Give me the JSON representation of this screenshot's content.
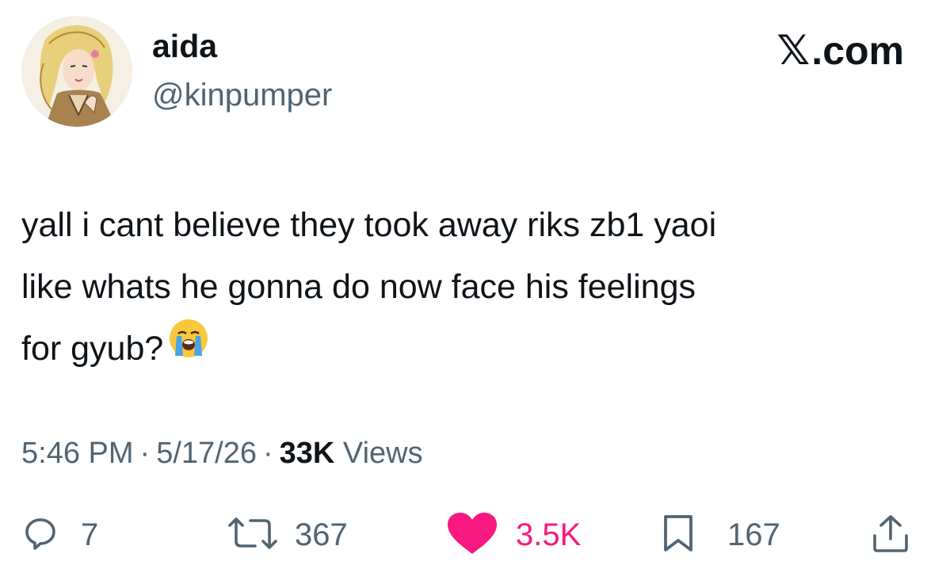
{
  "author": {
    "display_name": "aida",
    "handle": "@kinpumper",
    "avatar_icon": "profile-avatar"
  },
  "source": {
    "logo_glyph": "𝕏",
    "label": ".com"
  },
  "tweet": {
    "text_line_1": "yall i cant believe they took away riks zb1 yaoi",
    "text_line_2": "like whats he gonna do now face his feelings",
    "text_line_3": "for gyub?",
    "emoji_icon": "loudly-crying-face-icon"
  },
  "meta": {
    "time": "5:46 PM",
    "separator": "·",
    "date": "5/17/26",
    "views_count": "33K",
    "views_label": "Views"
  },
  "actions": {
    "replies": "7",
    "reposts": "367",
    "likes": "3.5K",
    "bookmarks": "167",
    "reply_icon": "reply-icon",
    "repost_icon": "repost-icon",
    "like_icon": "heart-icon",
    "bookmark_icon": "bookmark-icon",
    "share_icon": "share-icon"
  },
  "colors": {
    "text": "#0f1419",
    "secondary": "#536471",
    "like": "#f91880",
    "background": "#ffffff"
  }
}
